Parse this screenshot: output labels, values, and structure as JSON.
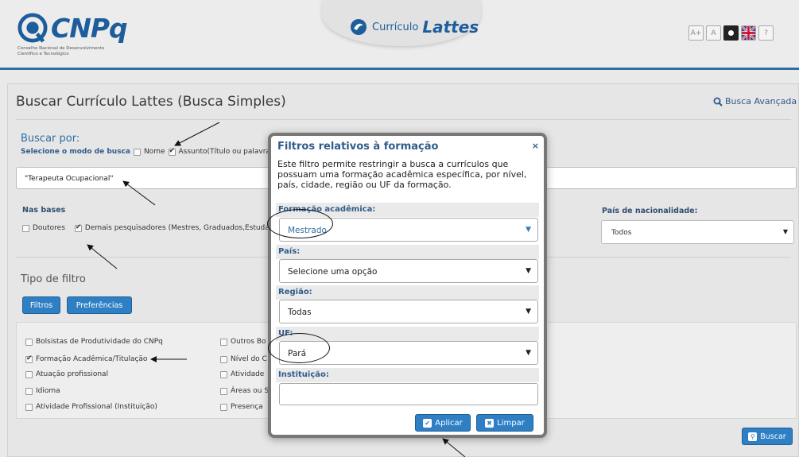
{
  "header": {
    "logo_name": "CNPq",
    "logo_subtitle": "Conselho Nacional de Desenvolvimento Científico e Tecnológico",
    "product_prefix": "Currículo",
    "product_name": "Lattes",
    "tools": [
      "A+",
      "A",
      "",
      "",
      "?"
    ]
  },
  "page": {
    "title": "Buscar Currículo Lattes (Busca Simples)",
    "advanced_link": "Busca Avançada"
  },
  "search": {
    "section_label": "Buscar por:",
    "mode_label": "Selecione o modo de busca",
    "mode_nome": "Nome",
    "mode_nome_checked": false,
    "mode_assunto": "Assunto(Título ou palavra",
    "mode_assunto_checked": true,
    "query": "\"Terapeuta Ocupacional\""
  },
  "bases": {
    "label": "Nas bases",
    "doutores": "Doutores",
    "doutores_checked": false,
    "demais": "Demais pesquisadores (Mestres, Graduados,Estudan",
    "demais_checked": true
  },
  "nacionalidade": {
    "label": "País de nacionalidade:",
    "value": "Todos"
  },
  "filter_type": {
    "label": "Tipo de filtro",
    "tab_filtros": "Filtros",
    "tab_preferencias": "Preferências"
  },
  "filters": {
    "col1": [
      {
        "label": "Bolsistas de Produtividade do CNPq",
        "checked": false
      },
      {
        "label": "Formação Acadêmica/Titulação",
        "checked": true
      },
      {
        "label": "Atuação profissional",
        "checked": false
      },
      {
        "label": "Idioma",
        "checked": false
      },
      {
        "label": "Atividade Profissional (Instituição)",
        "checked": false
      }
    ],
    "col2": [
      {
        "label": "Outros Bo",
        "checked": false
      },
      {
        "label": "Nível do C",
        "checked": false
      },
      {
        "label": "Atividade",
        "checked": false
      },
      {
        "label": "Áreas ou S",
        "checked": false
      },
      {
        "label": "Presença",
        "checked": false
      }
    ]
  },
  "buscar_button": "Buscar",
  "dialog": {
    "title": "Filtros relativos à formação",
    "close": "×",
    "description": "Este filtro permite restringir a busca a currículos que possuam uma formação acadêmica específica, por nível, país, cidade, região ou UF da formação.",
    "formacao_label": "Formação acadêmica:",
    "formacao_value": "Mestrado",
    "pais_label": "País:",
    "pais_value": "Selecione uma opção",
    "regiao_label": "Região:",
    "regiao_value": "Todas",
    "uf_label": "UF:",
    "uf_value": "Pará",
    "instituicao_label": "Instituição:",
    "instituicao_value": "",
    "apply_button": "Aplicar",
    "clear_button": "Limpar"
  },
  "colors": {
    "brand_blue": "#2f7fc4",
    "title_blue": "#2f5c8a",
    "header_rule": "#2f6ea3"
  }
}
